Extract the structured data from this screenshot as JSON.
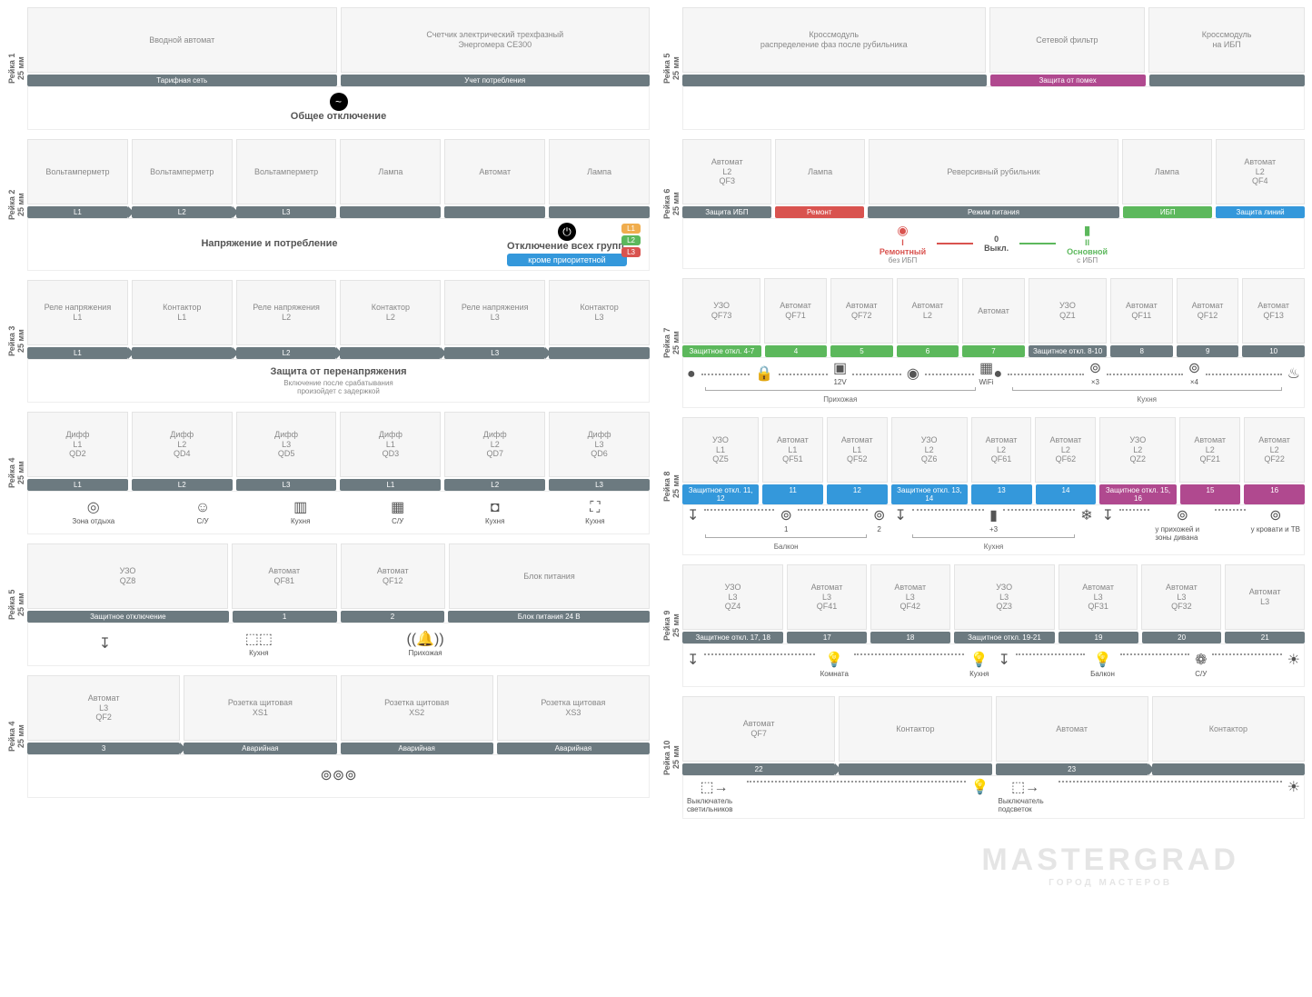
{
  "watermark": {
    "main": "MASTERGRAD",
    "sub": "ГОРОД МАСТЕРОВ"
  },
  "left": {
    "rail1": {
      "label": "Рейка 1\n25 мм",
      "modules": [
        [
          "Вводной автомат",
          "",
          "",
          ""
        ],
        [
          "Счетчик электрический трехфазный",
          "Энергомера CE300",
          "",
          ""
        ]
      ],
      "tags": [
        {
          "t": "Тарифная сеть"
        },
        {
          "t": "Учет потребления"
        }
      ],
      "band": {
        "icon": "~",
        "title": "Общее отключение"
      }
    },
    "rail2": {
      "label": "Рейка 2\n25 мм",
      "modules": [
        [
          "Вольтамперметр"
        ],
        [
          "Вольтамперметр"
        ],
        [
          "Вольтамперметр"
        ],
        [
          "Лампа"
        ],
        [
          "Автомат"
        ],
        [
          "Лампа"
        ]
      ],
      "tags": [
        {
          "t": "L1",
          "arrow": true
        },
        {
          "t": "L2",
          "arrow": true
        },
        {
          "t": "L3"
        },
        {
          "t": ""
        },
        {
          "t": ""
        },
        {
          "t": ""
        }
      ],
      "band": {
        "left": "Напряжение и потребление",
        "right": "Отключение всех групп,",
        "btn": "кроме приоритетной",
        "pills": [
          "L1",
          "L2",
          "L3"
        ]
      }
    },
    "rail3": {
      "label": "Рейка 3\n25 мм",
      "modules": [
        [
          "Реле напряжения",
          "L1"
        ],
        [
          "Контактор",
          "L1"
        ],
        [
          "Реле напряжения",
          "L2"
        ],
        [
          "Контактор",
          "L2"
        ],
        [
          "Реле напряжения",
          "L3"
        ],
        [
          "Контактор",
          "L3"
        ]
      ],
      "tags": [
        {
          "t": "L1",
          "arrow": true
        },
        {
          "t": "",
          "arrow": true
        },
        {
          "t": "L2",
          "arrow": true
        },
        {
          "t": "",
          "arrow": true
        },
        {
          "t": "L3",
          "arrow": true
        },
        {
          "t": ""
        }
      ],
      "band": {
        "title": "Защита от перенапряжения",
        "sub1": "Включение после срабатывания",
        "sub2": "произойдет с задержкой"
      }
    },
    "rail4": {
      "label": "Рейка 4\n25 мм",
      "modules": [
        [
          "Дифф",
          "L1",
          "QD2"
        ],
        [
          "Дифф",
          "L2",
          "QD4"
        ],
        [
          "Дифф",
          "L3",
          "QD5"
        ],
        [
          "Дифф",
          "L1",
          "QD3"
        ],
        [
          "Дифф",
          "L2",
          "QD7"
        ],
        [
          "Дифф",
          "L3",
          "QD6"
        ]
      ],
      "tags": [
        {
          "t": "L1"
        },
        {
          "t": "L2"
        },
        {
          "t": "L3"
        },
        {
          "t": "L1"
        },
        {
          "t": "L2"
        },
        {
          "t": "L3"
        }
      ],
      "icons": [
        [
          "◎",
          "Зона отдыха"
        ],
        [
          "☺",
          "С/У"
        ],
        [
          "▥",
          "Кухня"
        ],
        [
          "▦",
          "С/У"
        ],
        [
          "◘",
          "Кухня"
        ],
        [
          "⛶",
          "Кухня"
        ]
      ]
    },
    "rail5": {
      "label": "Рейка 5\n25 мм",
      "modules": [
        [
          "УЗО",
          "",
          "QZ8"
        ],
        [
          "Автомат",
          "",
          "QF81"
        ],
        [
          "Автомат",
          "",
          "QF12"
        ],
        [
          "Блок питания",
          "",
          ""
        ]
      ],
      "modFlex": [
        2,
        1,
        1,
        2
      ],
      "tags": [
        {
          "t": "Защитное отключение",
          "f": 2
        },
        {
          "t": "1",
          "f": 1
        },
        {
          "t": "2",
          "f": 1
        },
        {
          "t": "Блок питания 24 В",
          "f": 2
        }
      ],
      "icons": [
        [
          "↧",
          ""
        ],
        [
          "⬚⬚",
          "Кухня"
        ],
        [
          "((🔔))",
          "Прихожая"
        ],
        [
          "",
          ""
        ]
      ]
    },
    "rail6": {
      "label": "Рейка 4\n25 мм",
      "modules": [
        [
          "Автомат",
          "L3",
          "QF2"
        ],
        [
          "Розетка щитовая",
          "",
          "XS1"
        ],
        [
          "Розетка щитовая",
          "",
          "XS2"
        ],
        [
          "Розетка щитовая",
          "",
          "XS3"
        ]
      ],
      "tags": [
        {
          "t": "3",
          "arrow": true
        },
        {
          "t": "Аварийная"
        },
        {
          "t": "Аварийная"
        },
        {
          "t": "Аварийная"
        }
      ],
      "icons": [
        [
          "⊚⊚⊚",
          ""
        ]
      ]
    }
  },
  "right": {
    "rail1": {
      "label": "Рейка 5\n25 мм",
      "modules": [
        [
          "Кроссмодуль",
          "распределение фаз после рубильника"
        ],
        [
          "Сетевой фильтр"
        ],
        [
          "Кроссмодуль",
          "на ИБП"
        ]
      ],
      "modFlex": [
        2,
        1,
        1
      ],
      "tags": [
        {
          "t": "",
          "f": 2
        },
        {
          "t": "Защита от помех",
          "c": "magenta",
          "f": 1
        },
        {
          "t": "",
          "f": 1
        }
      ]
    },
    "rail2": {
      "label": "Рейка 6\n25 мм",
      "modules": [
        [
          "Автомат",
          "L2",
          "QF3"
        ],
        [
          "Лампа"
        ],
        [
          "Реверсивный рубильник"
        ],
        [
          "Лампа"
        ],
        [
          "Автомат",
          "L2",
          "QF4"
        ]
      ],
      "modFlex": [
        1,
        1,
        3,
        1,
        1
      ],
      "tags": [
        {
          "t": "Защита ИБП"
        },
        {
          "t": "Ремонт",
          "c": "red"
        },
        {
          "t": "Режим питания",
          "f": 3
        },
        {
          "t": "ИБП",
          "c": "green"
        },
        {
          "t": "Защита линий",
          "c": "blue"
        }
      ],
      "modes": [
        {
          "icon": "◉",
          "num": "I",
          "label": "Ремонтный",
          "sub": "без ИБП",
          "cls": "red-txt"
        },
        {
          "num": "0",
          "label": "Выкл.",
          "sub": ""
        },
        {
          "icon": "▮",
          "num": "II",
          "label": "Основной",
          "sub": "с ИБП",
          "cls": "green-txt"
        }
      ]
    },
    "rail3": {
      "label": "Рейка 7\n25 мм",
      "modules": [
        [
          "УЗО",
          "",
          "QF73"
        ],
        [
          "Автомат",
          "",
          "QF71"
        ],
        [
          "Автомат",
          "",
          "QF72"
        ],
        [
          "Автомат",
          "L2"
        ],
        [
          "Автомат"
        ],
        [
          "УЗО",
          "",
          "QZ1"
        ],
        [
          "Автомат",
          "",
          "QF11"
        ],
        [
          "Автомат",
          "",
          "QF12"
        ],
        [
          "Автомат",
          "",
          "QF13"
        ]
      ],
      "modFlex": [
        1.3,
        1,
        1,
        1,
        1,
        1.3,
        1,
        1,
        1
      ],
      "tags": [
        {
          "t": "Защитное откл. 4-7",
          "c": "green",
          "f": 1.3
        },
        {
          "t": "4",
          "c": "green"
        },
        {
          "t": "5",
          "c": "green"
        },
        {
          "t": "6",
          "c": "green"
        },
        {
          "t": "7",
          "c": "green"
        },
        {
          "t": "Защитное откл. 8-10",
          "f": 1.3
        },
        {
          "t": "8"
        },
        {
          "t": "9"
        },
        {
          "t": "10"
        }
      ],
      "iconRow": {
        "left": [
          [
            "●",
            ""
          ],
          [
            "🔒",
            ""
          ],
          [
            "▣",
            "12V"
          ],
          [
            "◉",
            ""
          ],
          [
            "▦",
            "WiFi"
          ]
        ],
        "leftLabel": "Прихожая",
        "right": [
          [
            "●",
            ""
          ],
          [
            "⊚",
            "×3"
          ],
          [
            "⊚",
            "×4"
          ],
          [
            "♨",
            ""
          ]
        ],
        "rightLabel": "Кухня"
      }
    },
    "rail4": {
      "label": "Рейка 8\n25 мм",
      "modules": [
        [
          "УЗО",
          "L1",
          "QZ5"
        ],
        [
          "Автомат",
          "L1",
          "QF51"
        ],
        [
          "Автомат",
          "L1",
          "QF52"
        ],
        [
          "УЗО",
          "L2",
          "QZ6"
        ],
        [
          "Автомат",
          "L2",
          "QF61"
        ],
        [
          "Автомат",
          "L2",
          "QF62"
        ],
        [
          "УЗО",
          "L2",
          "QZ2"
        ],
        [
          "Автомат",
          "L2",
          "QF21"
        ],
        [
          "Автомат",
          "L2",
          "QF22"
        ]
      ],
      "modFlex": [
        1.3,
        1,
        1,
        1.3,
        1,
        1,
        1.3,
        1,
        1
      ],
      "tags": [
        {
          "t": "Защитное откл. 11, 12",
          "c": "blue",
          "f": 1.3
        },
        {
          "t": "11",
          "c": "blue"
        },
        {
          "t": "12",
          "c": "blue"
        },
        {
          "t": "Защитное откл. 13, 14",
          "c": "blue",
          "f": 1.3
        },
        {
          "t": "13",
          "c": "blue"
        },
        {
          "t": "14",
          "c": "blue"
        },
        {
          "t": "Защитное откл. 15, 16",
          "c": "magenta",
          "f": 1.3
        },
        {
          "t": "15",
          "c": "magenta"
        },
        {
          "t": "16",
          "c": "magenta"
        }
      ],
      "iconRow": {
        "groups": [
          {
            "label": "Балкон",
            "items": [
              [
                "↧",
                ""
              ],
              [
                "⊚",
                "1"
              ],
              [
                "⊚",
                "2"
              ]
            ]
          },
          {
            "label": "Кухня",
            "items": [
              [
                "↧",
                ""
              ],
              [
                "▮",
                "+3"
              ],
              [
                "❄",
                ""
              ]
            ]
          },
          {
            "label": "",
            "items": [
              [
                "↧",
                ""
              ],
              [
                "⊚",
                "у прихожей и зоны дивана"
              ],
              [
                "⊚",
                "у кровати и ТВ"
              ]
            ]
          }
        ]
      }
    },
    "rail5": {
      "label": "Рейка 9\n25 мм",
      "modules": [
        [
          "УЗО",
          "L3",
          "QZ4"
        ],
        [
          "Автомат",
          "L3",
          "QF41"
        ],
        [
          "Автомат",
          "L3",
          "QF42"
        ],
        [
          "УЗО",
          "L3",
          "QZ3"
        ],
        [
          "Автомат",
          "L3",
          "QF31"
        ],
        [
          "Автомат",
          "L3",
          "QF32"
        ],
        [
          "Автомат",
          "L3"
        ]
      ],
      "modFlex": [
        1.3,
        1,
        1,
        1.3,
        1,
        1,
        1
      ],
      "tags": [
        {
          "t": "Защитное откл. 17, 18",
          "f": 1.3
        },
        {
          "t": "17"
        },
        {
          "t": "18"
        },
        {
          "t": "Защитное откл. 19-21",
          "f": 1.3
        },
        {
          "t": "19"
        },
        {
          "t": "20"
        },
        {
          "t": "21"
        }
      ],
      "iconRow": {
        "groups": [
          {
            "label": "",
            "items": [
              [
                "↧",
                ""
              ],
              [
                "💡",
                "Комната"
              ],
              [
                "💡",
                "Кухня"
              ]
            ]
          },
          {
            "label": "",
            "items": [
              [
                "↧",
                ""
              ],
              [
                "💡",
                "Балкон"
              ],
              [
                "❁",
                "С/У"
              ],
              [
                "☀",
                ""
              ]
            ]
          }
        ]
      }
    },
    "rail6": {
      "label": "Рейка 10\n25 мм",
      "modules": [
        [
          "Автомат",
          "",
          "QF7"
        ],
        [
          "Контактор"
        ],
        [
          "Автомат"
        ],
        [
          "Контактор"
        ]
      ],
      "tags": [
        {
          "t": "22",
          "arrow": true
        },
        {
          "t": ""
        },
        {
          "t": "23",
          "arrow": true
        },
        {
          "t": ""
        }
      ],
      "iconRow": {
        "groups": [
          {
            "label": "",
            "items": [
              [
                "⬚→",
                "Выключатель светильников",
                "dotted",
                "💡"
              ]
            ]
          },
          {
            "label": "",
            "items": [
              [
                "⬚→",
                "Выключатель подсветок",
                "dotted",
                "☀"
              ]
            ]
          }
        ]
      }
    }
  }
}
